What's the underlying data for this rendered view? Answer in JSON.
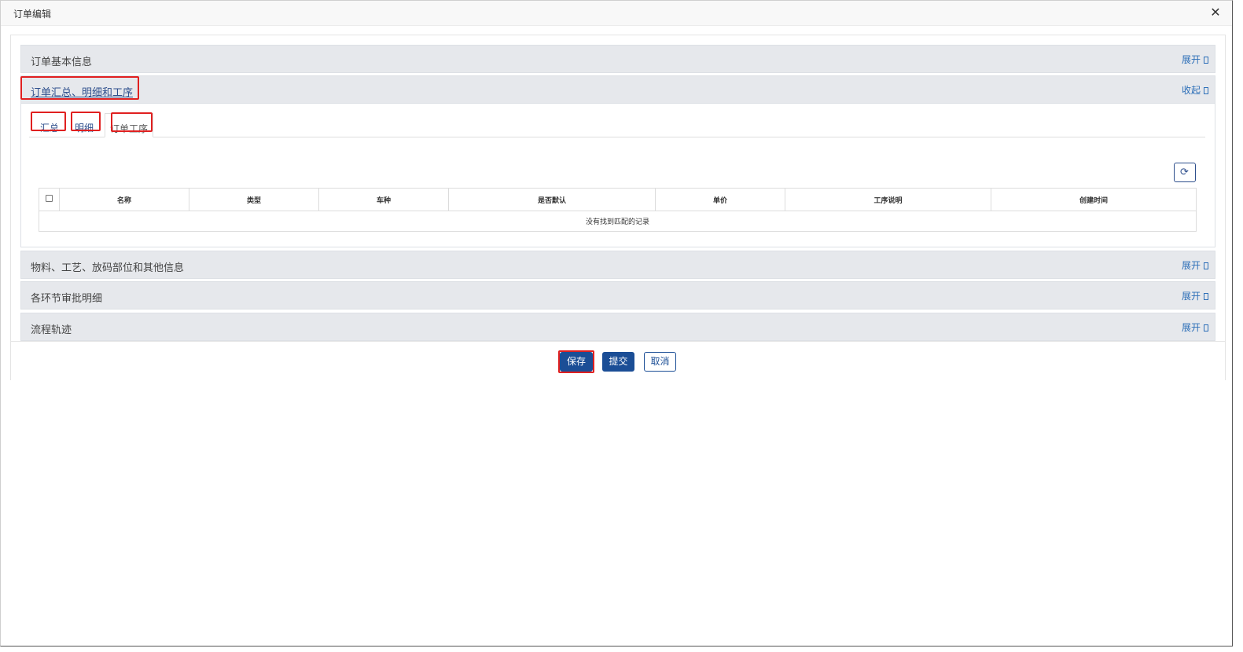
{
  "window": {
    "title": "订单编辑",
    "close_glyph": "✕"
  },
  "sections": [
    {
      "title": "订单基本信息",
      "toggle": "展开"
    },
    {
      "title": "订单汇总、明细和工序",
      "toggle": "收起"
    },
    {
      "title": "物料、工艺、放码部位和其他信息",
      "toggle": "展开"
    },
    {
      "title": "各环节审批明细",
      "toggle": "展开"
    },
    {
      "title": "流程轨迹",
      "toggle": "展开"
    }
  ],
  "tabs": [
    {
      "label": "汇总"
    },
    {
      "label": "明细"
    },
    {
      "label": "订单工序",
      "active": true
    }
  ],
  "table": {
    "columns": [
      "名称",
      "类型",
      "车种",
      "是否默认",
      "单价",
      "工序说明",
      "创建时间"
    ],
    "empty_message": "没有找到匹配的记录"
  },
  "icons": {
    "refresh": "refresh-icon",
    "close": "close-icon"
  },
  "buttons": {
    "save": "保存",
    "submit": "提交",
    "cancel": "取消"
  },
  "colors": {
    "primary": "#1b4e96",
    "highlight": "#e02020",
    "section_bg": "#e6e8ec",
    "link": "#2d6fb8"
  }
}
